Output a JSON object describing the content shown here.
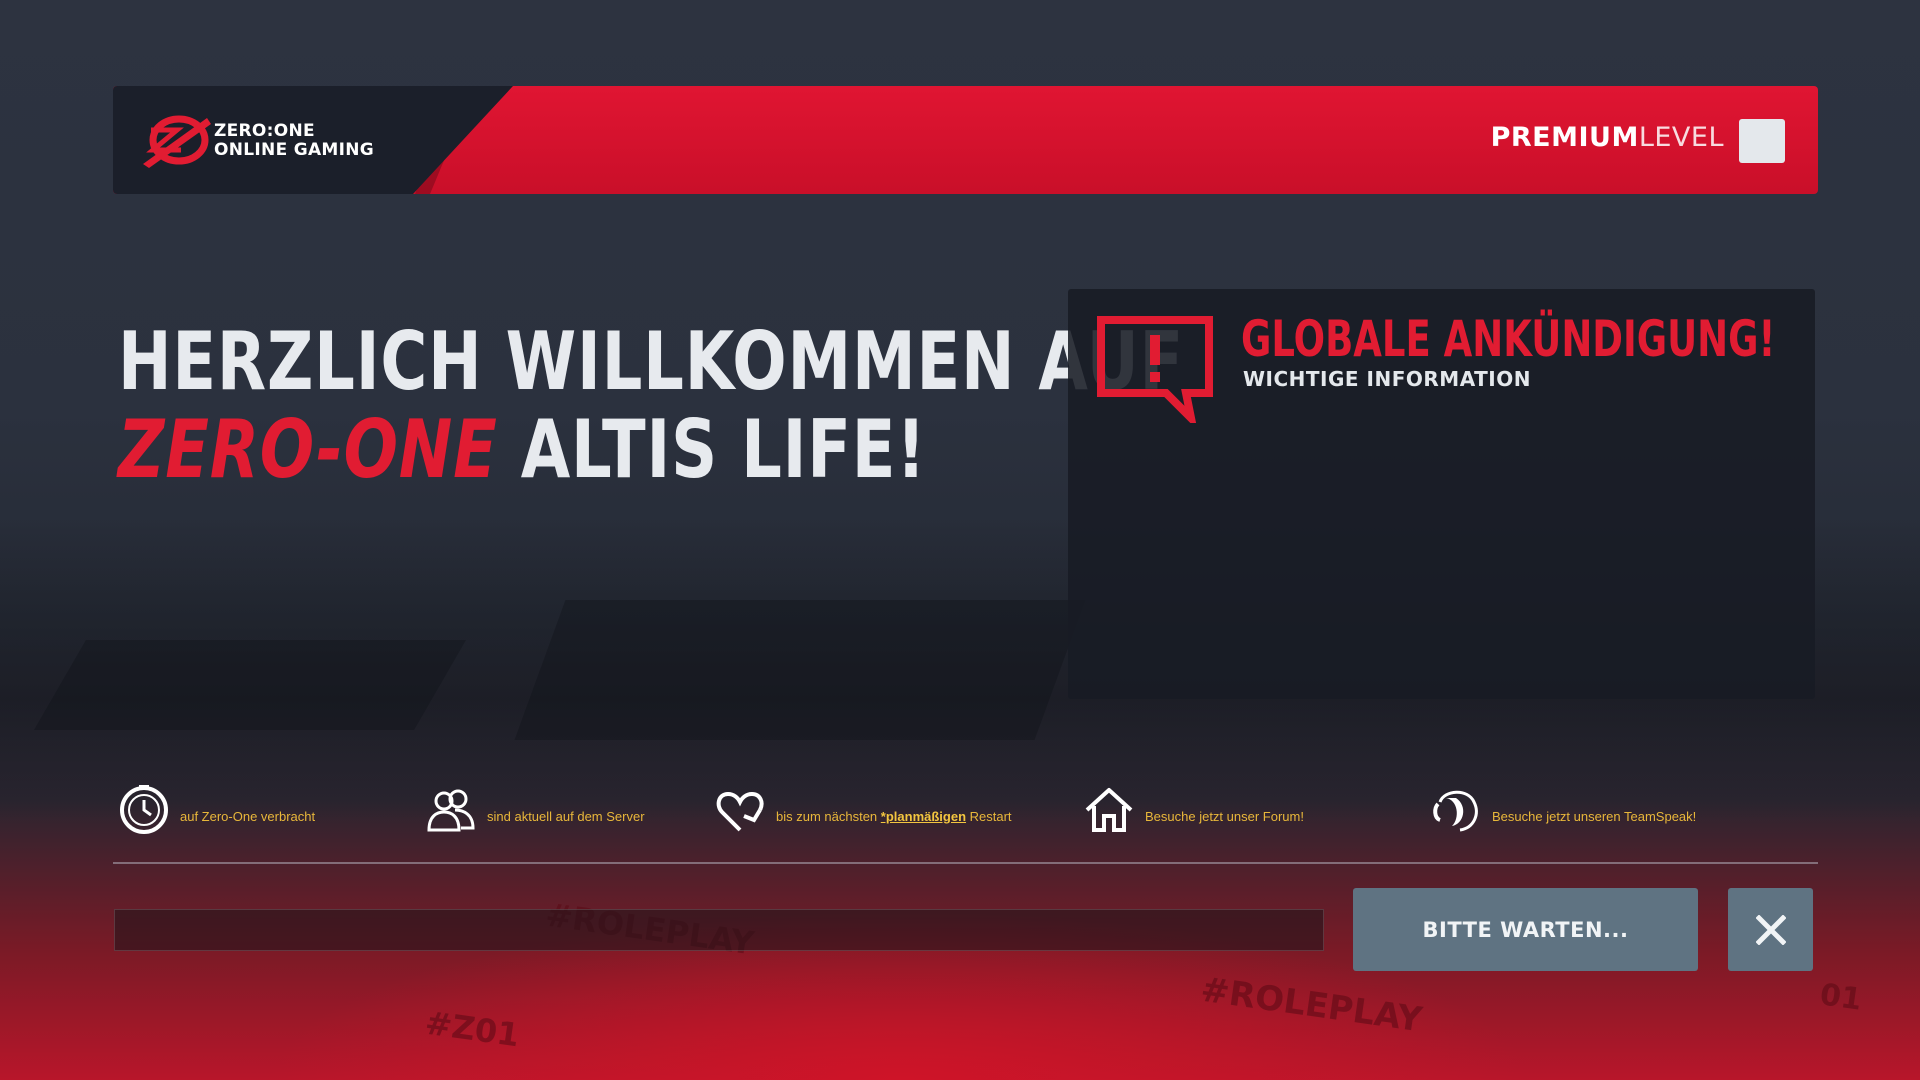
{
  "header": {
    "logo_line1": "ZERO:ONE",
    "logo_line2": "ONLINE GAMING",
    "premium_bold": "PREMIUM",
    "premium_light": "LEVEL"
  },
  "welcome": {
    "line1": "HERZLICH WILLKOMMEN AUF",
    "line2_red": "ZERO-ONE",
    "line2_rest": " ALTIS LIFE!"
  },
  "announcement": {
    "title": "GLOBALE ANKÜNDIGUNG!",
    "subtitle": "WICHTIGE INFORMATION",
    "icon": "alert-speech-bubble-icon"
  },
  "stats": [
    {
      "icon": "clock-icon",
      "text": "auf Zero-One verbracht"
    },
    {
      "icon": "users-icon",
      "text": "sind aktuell auf dem Server"
    },
    {
      "icon": "heart-refresh-icon",
      "pre": "bis zum nächsten ",
      "highlight": "*planmäßigen",
      "post": " Restart"
    },
    {
      "icon": "home-icon",
      "text": "Besuche jetzt unser Forum!"
    },
    {
      "icon": "teamspeak-icon",
      "text": "Besuche jetzt unseren TeamSpeak!"
    }
  ],
  "controls": {
    "wait_label": "BITTE WARTEN...",
    "close_icon": "close-icon"
  },
  "colors": {
    "accent_red": "#e11c32",
    "header_red": "#d0102b",
    "dark_panel": "#1b1f2a",
    "button_slate": "#5f7382",
    "stat_yellow": "#e8b73a"
  }
}
